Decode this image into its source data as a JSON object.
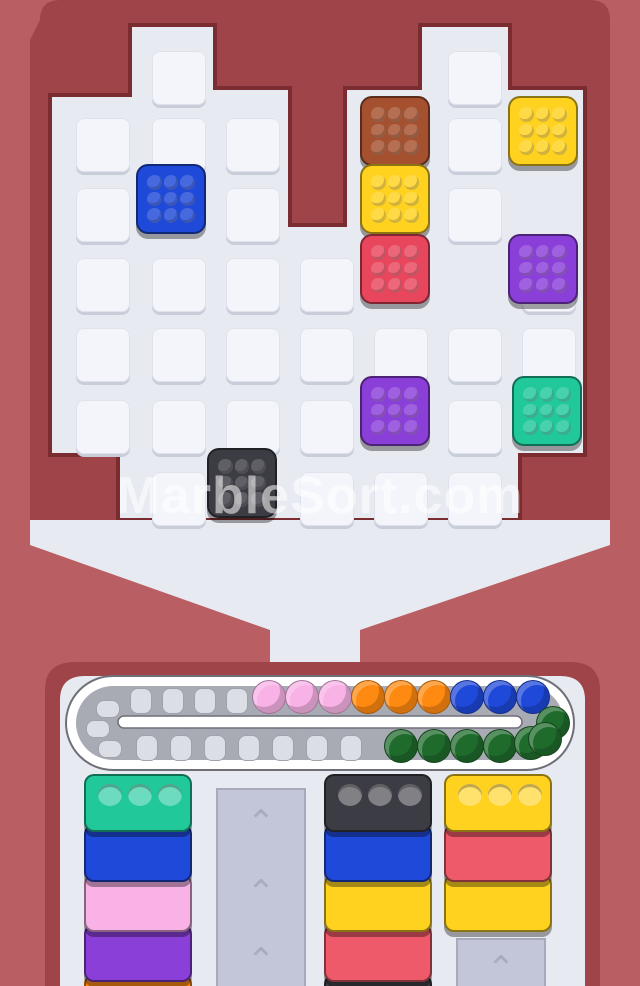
{
  "watermark": "MarbleSort.com",
  "colors": {
    "brown": "#a5512f",
    "yellow": "#ffd21f",
    "blue": "#1f49d8",
    "red": "#e8465c",
    "purple": "#8b3fd9",
    "teal": "#20c89a",
    "black": "#3c3c44",
    "pink": "#f8b2e6",
    "orange": "#ff8a12",
    "green": "#1f6b2c",
    "salmon": "#ef5a6a"
  },
  "board": {
    "blocks": [
      {
        "name": "brown-block",
        "color": "#a5512f"
      },
      {
        "name": "yellow-block-top-right",
        "color": "#ffd21f"
      },
      {
        "name": "blue-block",
        "color": "#1f49d8"
      },
      {
        "name": "yellow-block",
        "color": "#ffd21f"
      },
      {
        "name": "red-block",
        "color": "#e8465c"
      },
      {
        "name": "purple-block-right",
        "color": "#8b3fd9"
      },
      {
        "name": "purple-block",
        "color": "#8b3fd9"
      },
      {
        "name": "teal-block",
        "color": "#20c89a"
      },
      {
        "name": "black-block",
        "color": "#3c3c44"
      }
    ]
  },
  "conveyor": {
    "marbles_top": [
      "#f8b2e6",
      "#f8b2e6",
      "#f8b2e6",
      "#ff8a12",
      "#ff8a12",
      "#ff8a12",
      "#1f49d8",
      "#1f49d8",
      "#1f49d8"
    ],
    "marbles_bottom": [
      "#1f6b2c",
      "#1f6b2c",
      "#1f6b2c",
      "#1f6b2c",
      "#1f6b2c",
      "#1f6b2c",
      "#1f6b2c"
    ]
  },
  "stacks": [
    {
      "name": "stack-left",
      "cups": [
        "#20c89a",
        "#1f49d8",
        "#f8b2e6",
        "#8b3fd9",
        "#ff8a12"
      ]
    },
    {
      "name": "stack-middle",
      "cups": [
        "#3c3c44",
        "#1f49d8",
        "#ffd21f",
        "#ef5a6a",
        "#3c3c44"
      ]
    },
    {
      "name": "stack-right",
      "cups": [
        "#ffd21f",
        "#ef5a6a",
        "#ffd21f"
      ]
    }
  ]
}
